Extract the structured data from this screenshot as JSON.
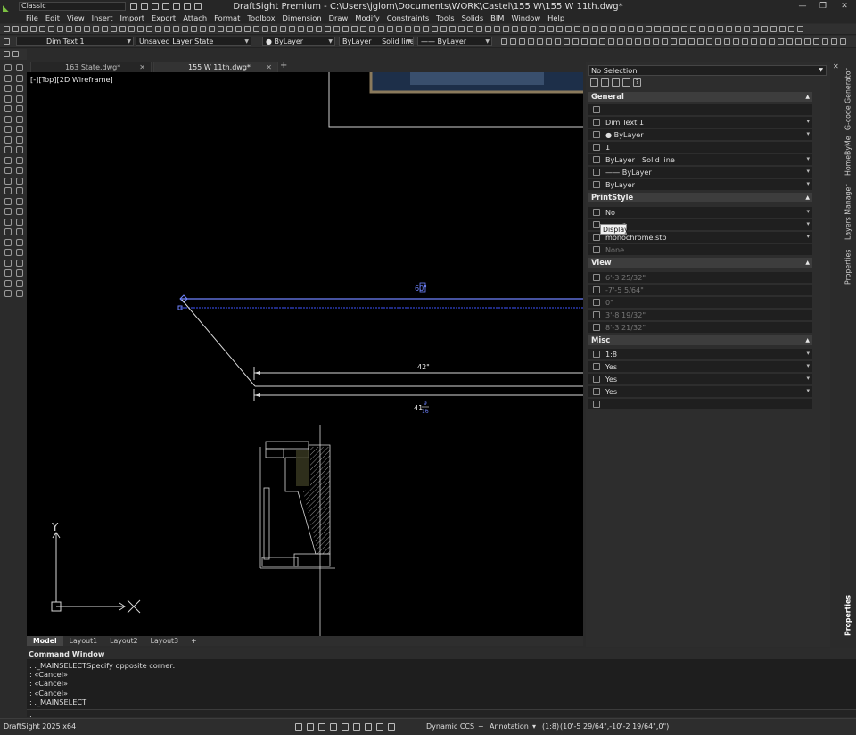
{
  "app": {
    "workspace": "Classic",
    "window_title": "DraftSight Premium - C:\\Users\\jglom\\Documents\\WORK\\Castel\\155 W\\155 W 11th.dwg*",
    "win_min": "—",
    "win_max": "❐",
    "win_close": "✕"
  },
  "menu": [
    "File",
    "Edit",
    "View",
    "Insert",
    "Import",
    "Export",
    "Attach",
    "Format",
    "Toolbox",
    "Dimension",
    "Draw",
    "Modify",
    "Constraints",
    "Tools",
    "Solids",
    "BIM",
    "Window",
    "Help"
  ],
  "toolbar": {
    "dim_style": "Dim Text 1",
    "layer_state": "Unsaved Layer State",
    "color": "ByLayer",
    "linestyle_layer": "ByLayer",
    "linestyle": "Solid line",
    "lineweight": "ByLayer"
  },
  "doc_tabs": [
    {
      "label": "163 State.dwg*",
      "close": "✕"
    },
    {
      "label": "155 W 11th.dwg*",
      "close": "✕"
    }
  ],
  "plus": "+",
  "viewport": {
    "label": "[-][Top][2D Wireframe]",
    "dim_top": "60\"",
    "dim_42": "42\"",
    "dim_41": "41",
    "dim_frac_num": "9",
    "dim_frac_den": "16",
    "ucs_y": "Y"
  },
  "layout_tabs": [
    "Model",
    "Layout1",
    "Layout2",
    "Layout3"
  ],
  "command": {
    "title": "Command Window",
    "lines": [
      ": ._MAINSELECTSpecify opposite corner:",
      ": «Cancel»",
      ": «Cancel»",
      ": «Cancel»",
      ": ._MAINSELECT",
      ":"
    ]
  },
  "status": {
    "app_version": "DraftSight 2025 x64",
    "ccs": "Dynamic CCS",
    "annotation": "Annotation",
    "scale": "(1:8)",
    "coords": "(10'-5 29/64\",-10'-2 19/64\",0\")"
  },
  "properties": {
    "selection": "No Selection",
    "tooltip": "Display",
    "sections": {
      "general": "General",
      "printstyle": "PrintStyle",
      "view": "View",
      "misc": "Misc"
    },
    "general_rows": [
      "",
      "Dim Text 1",
      "● ByLayer",
      "1",
      "ByLayer",
      "—— ByLayer",
      "ByLayer"
    ],
    "general_linestyle_extra": "Solid line",
    "printstyle_rows": [
      "No",
      "r",
      "monochrome.stb",
      "None"
    ],
    "view_rows": [
      "6'-3 25/32\"",
      "-7'-5 5/64\"",
      "0\"",
      "3'-8 19/32\"",
      "8'-3 21/32\""
    ],
    "misc_rows": [
      "1:8",
      "Yes",
      "Yes",
      "Yes",
      ""
    ]
  },
  "side_tabs": [
    "G-code Generator",
    "HomeByMe",
    "Layers Manager",
    "Properties",
    "Properties"
  ]
}
